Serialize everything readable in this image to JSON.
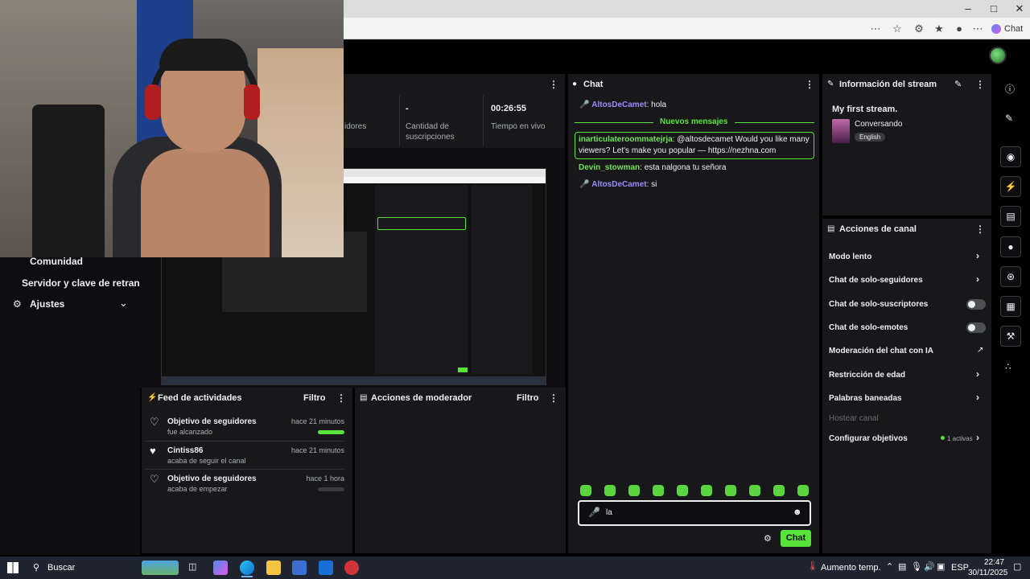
{
  "browser": {
    "copilot_label": "Chat",
    "icons": [
      "reader-icon",
      "star-icon",
      "extensions-icon",
      "favorites-icon",
      "profile-icon",
      "more-icon"
    ]
  },
  "stats": {
    "items": [
      {
        "value": "",
        "label": "idores"
      },
      {
        "value": "-",
        "label": "Cantidad de suscripciones"
      },
      {
        "value": "00:26:55",
        "label": "Tiempo en vivo"
      }
    ]
  },
  "nav": {
    "items": [
      {
        "label": "Comunidad"
      },
      {
        "label": "Servidor y clave de retrans"
      },
      {
        "label": "Ajustes"
      }
    ]
  },
  "feed": {
    "title": "Feed de actividades",
    "filter": "Filtro",
    "items": [
      {
        "title": "Objetivo de seguidores",
        "sub": "fue alcanzado",
        "time": "hace 21 minutos",
        "progress": 1.0
      },
      {
        "title": "Cintiss86",
        "sub": "acaba de seguir el canal",
        "time": "hace 21 minutos"
      },
      {
        "title": "Objetivo de seguidores",
        "sub": "acaba de empezar",
        "time": "hace 1 hora",
        "progress": 0.0
      }
    ]
  },
  "moderator": {
    "title": "Acciones de moderador",
    "filter": "Filtro"
  },
  "chat": {
    "title": "Chat",
    "new_messages": "Nuevos mensajes",
    "messages": [
      {
        "user": "AltosDeCamet",
        "text": ": hola"
      },
      {
        "user": "inarticulateroommatejrja",
        "text": ": @altosdecamet Would you like many viewers? Let's make you popular — https://nezhna.com"
      },
      {
        "user": "Devin_stowman",
        "text": ": esta nalgona tu señora"
      },
      {
        "user": "AltosDeCamet",
        "text": ": si"
      }
    ],
    "input_value": "la",
    "send_label": "Chat"
  },
  "stream_info": {
    "title": "Información del stream",
    "stream_title": "My first stream.",
    "category": "Conversando",
    "language": "English"
  },
  "channel_actions": {
    "title": "Acciones de canal",
    "items": [
      {
        "label": "Modo lento",
        "control": "chevron"
      },
      {
        "label": "Chat de solo-seguidores",
        "control": "chevron"
      },
      {
        "label": "Chat de solo-suscriptores",
        "control": "toggle"
      },
      {
        "label": "Chat de solo-emotes",
        "control": "toggle"
      },
      {
        "label": "Moderación del chat con IA",
        "control": "external"
      },
      {
        "label": "Restricción de edad",
        "control": "chevron"
      },
      {
        "label": "Palabras baneadas",
        "control": "chevron"
      },
      {
        "label": "Hostear canal",
        "control": "none"
      },
      {
        "label": "Configurar objetivos",
        "control": "chevron",
        "badge": "1 activas"
      }
    ]
  },
  "taskbar": {
    "search": "Buscar",
    "weather": "Aumento temp.",
    "lang": "ESP",
    "time": "22:47",
    "date": "30/11/2025"
  },
  "colors": {
    "accent": "#58e33a",
    "panel": "#18181b",
    "background": "#0e0e10"
  }
}
